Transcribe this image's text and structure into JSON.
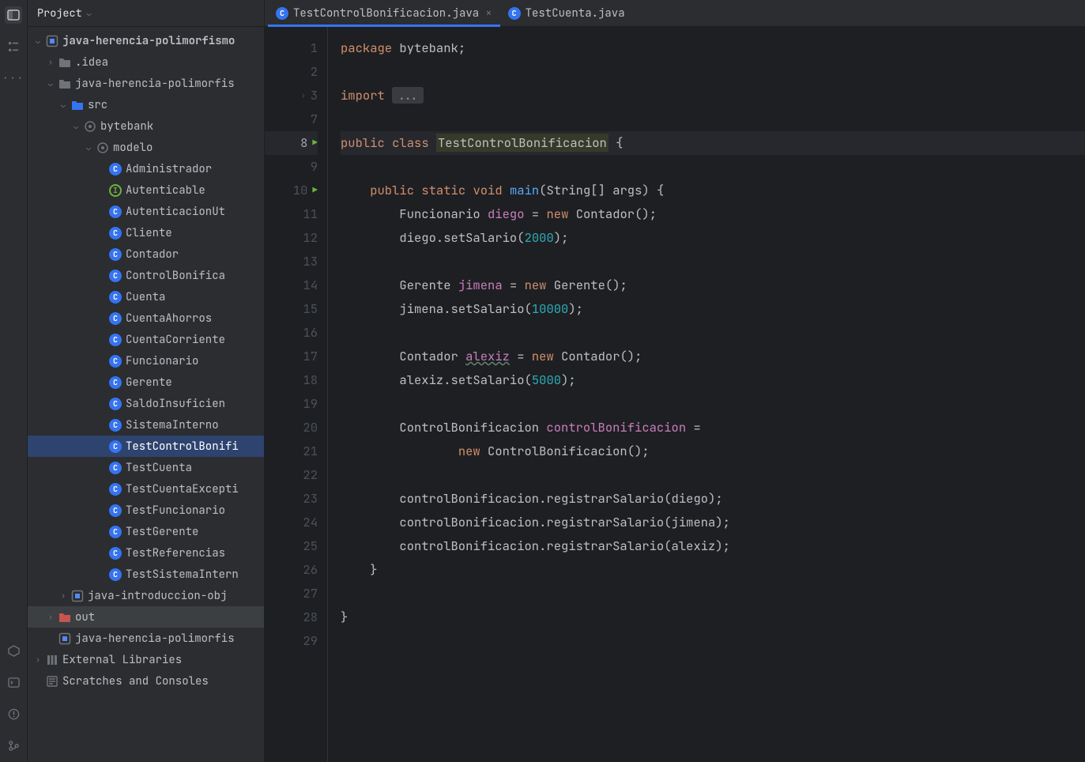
{
  "sidebar": {
    "title": "Project",
    "items": [
      {
        "indent": 0,
        "chevron": "down",
        "icon": "module",
        "label": "java-herencia-polimorfismo",
        "bold": true
      },
      {
        "indent": 1,
        "chevron": "right",
        "icon": "folder-grey",
        "label": ".idea"
      },
      {
        "indent": 1,
        "chevron": "down",
        "icon": "folder-grey",
        "label": "java-herencia-polimorfis"
      },
      {
        "indent": 2,
        "chevron": "down",
        "icon": "folder-blue",
        "label": "src"
      },
      {
        "indent": 3,
        "chevron": "down",
        "icon": "package",
        "label": "bytebank"
      },
      {
        "indent": 4,
        "chevron": "down",
        "icon": "package",
        "label": "modelo"
      },
      {
        "indent": 5,
        "chevron": "",
        "icon": "class",
        "label": "Administrador"
      },
      {
        "indent": 5,
        "chevron": "",
        "icon": "interface",
        "label": "Autenticable"
      },
      {
        "indent": 5,
        "chevron": "",
        "icon": "class",
        "label": "AutenticacionUt"
      },
      {
        "indent": 5,
        "chevron": "",
        "icon": "class",
        "label": "Cliente"
      },
      {
        "indent": 5,
        "chevron": "",
        "icon": "class",
        "label": "Contador"
      },
      {
        "indent": 5,
        "chevron": "",
        "icon": "class",
        "label": "ControlBonifica"
      },
      {
        "indent": 5,
        "chevron": "",
        "icon": "class",
        "label": "Cuenta"
      },
      {
        "indent": 5,
        "chevron": "",
        "icon": "class",
        "label": "CuentaAhorros"
      },
      {
        "indent": 5,
        "chevron": "",
        "icon": "class",
        "label": "CuentaCorriente"
      },
      {
        "indent": 5,
        "chevron": "",
        "icon": "class",
        "label": "Funcionario"
      },
      {
        "indent": 5,
        "chevron": "",
        "icon": "class",
        "label": "Gerente"
      },
      {
        "indent": 5,
        "chevron": "",
        "icon": "class",
        "label": "SaldoInsuficien"
      },
      {
        "indent": 5,
        "chevron": "",
        "icon": "class",
        "label": "SistemaInterno"
      },
      {
        "indent": 5,
        "chevron": "",
        "icon": "class",
        "label": "TestControlBonifi",
        "selected": true
      },
      {
        "indent": 5,
        "chevron": "",
        "icon": "class",
        "label": "TestCuenta"
      },
      {
        "indent": 5,
        "chevron": "",
        "icon": "class",
        "label": "TestCuentaExcepti"
      },
      {
        "indent": 5,
        "chevron": "",
        "icon": "class",
        "label": "TestFuncionario"
      },
      {
        "indent": 5,
        "chevron": "",
        "icon": "class",
        "label": "TestGerente"
      },
      {
        "indent": 5,
        "chevron": "",
        "icon": "class",
        "label": "TestReferencias"
      },
      {
        "indent": 5,
        "chevron": "",
        "icon": "class",
        "label": "TestSistemaIntern"
      },
      {
        "indent": 2,
        "chevron": "right",
        "icon": "module",
        "label": "java-introduccion-obj"
      },
      {
        "indent": 1,
        "chevron": "right",
        "icon": "folder-orange",
        "label": "out",
        "selected2": true
      },
      {
        "indent": 1,
        "chevron": "",
        "icon": "module",
        "label": "java-herencia-polimorfis"
      },
      {
        "indent": 0,
        "chevron": "right",
        "icon": "lib",
        "label": "External Libraries"
      },
      {
        "indent": 0,
        "chevron": "",
        "icon": "scratch",
        "label": "Scratches and Consoles"
      }
    ]
  },
  "tabs": [
    {
      "icon": "class",
      "label": "TestControlBonificacion.java",
      "active": true,
      "close": true
    },
    {
      "icon": "class",
      "label": "TestCuenta.java",
      "active": false,
      "close": false
    }
  ],
  "code_lines": [
    {
      "n": "1",
      "html": "<span class='kw'>package</span> <span class='pkg'>bytebank</span><span class='op'>;</span>"
    },
    {
      "n": "2",
      "html": ""
    },
    {
      "n": "3",
      "fold": ">",
      "html": "<span class='kw'>import</span> <span class='collapsed'>...</span>"
    },
    {
      "n": "7",
      "html": ""
    },
    {
      "n": "8",
      "run": true,
      "current": true,
      "html": "<span class='kw'>public</span> <span class='kw'>class</span> <span class='hlbox'>TestControlBonificacion</span> <span class='op'>{</span>"
    },
    {
      "n": "9",
      "html": ""
    },
    {
      "n": "10",
      "run": true,
      "html": "    <span class='kw'>public</span> <span class='kw'>static</span> <span class='kw'>void</span> <span class='fn'>main</span><span class='op'>(</span><span class='type'>String</span><span class='op'>[] </span><span class='var'>args</span><span class='op'>) {</span>"
    },
    {
      "n": "11",
      "html": "        <span class='type'>Funcionario</span> <span class='declvar'>diego</span> <span class='op'>=</span> <span class='kw'>new</span> <span class='type'>Contador</span><span class='op'>();</span>"
    },
    {
      "n": "12",
      "html": "        <span class='var'>diego</span><span class='op'>.</span><span class='method2'>setSalario</span><span class='op'>(</span><span class='num'>2000</span><span class='op'>);</span>"
    },
    {
      "n": "13",
      "html": ""
    },
    {
      "n": "14",
      "html": "        <span class='type'>Gerente</span> <span class='declvar'>jimena</span> <span class='op'>=</span> <span class='kw'>new</span> <span class='type'>Gerente</span><span class='op'>();</span>"
    },
    {
      "n": "15",
      "html": "        <span class='var'>jimena</span><span class='op'>.</span><span class='method2'>setSalario</span><span class='op'>(</span><span class='num'>10000</span><span class='op'>);</span>"
    },
    {
      "n": "16",
      "html": ""
    },
    {
      "n": "17",
      "html": "        <span class='type'>Contador</span> <span class='declvar wavy'>alexiz</span> <span class='op'>=</span> <span class='kw'>new</span> <span class='type'>Contador</span><span class='op'>();</span>"
    },
    {
      "n": "18",
      "html": "        <span class='var'>alexiz</span><span class='op'>.</span><span class='method2'>setSalario</span><span class='op'>(</span><span class='num'>5000</span><span class='op'>);</span>"
    },
    {
      "n": "19",
      "html": ""
    },
    {
      "n": "20",
      "html": "        <span class='type'>ControlBonificacion</span> <span class='declvar'>controlBonificacion</span> <span class='op'>=</span>"
    },
    {
      "n": "21",
      "html": "                <span class='kw'>new</span> <span class='type'>ControlBonificacion</span><span class='op'>();</span>"
    },
    {
      "n": "22",
      "html": ""
    },
    {
      "n": "23",
      "html": "        <span class='var'>controlBonificacion</span><span class='op'>.</span><span class='method2'>registrarSalario</span><span class='op'>(</span><span class='var'>diego</span><span class='op'>);</span>"
    },
    {
      "n": "24",
      "html": "        <span class='var'>controlBonificacion</span><span class='op'>.</span><span class='method2'>registrarSalario</span><span class='op'>(</span><span class='var'>jimena</span><span class='op'>);</span>"
    },
    {
      "n": "25",
      "html": "        <span class='var'>controlBonificacion</span><span class='op'>.</span><span class='method2'>registrarSalario</span><span class='op'>(</span><span class='var'>alexiz</span><span class='op'>);</span>"
    },
    {
      "n": "26",
      "html": "    <span class='op'>}</span>"
    },
    {
      "n": "27",
      "html": ""
    },
    {
      "n": "28",
      "html": "<span class='op'>}</span>"
    },
    {
      "n": "29",
      "html": ""
    }
  ]
}
